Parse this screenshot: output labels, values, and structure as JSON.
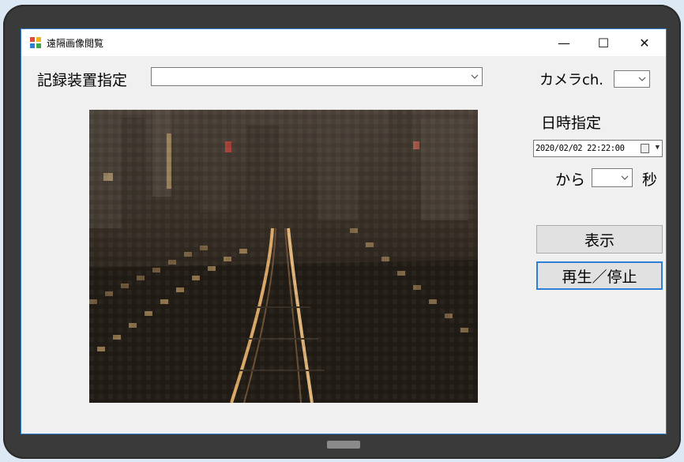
{
  "window": {
    "title": "遠隔画像閲覧",
    "minimize_glyph": "—",
    "maximize_glyph": "☐",
    "close_glyph": "✕"
  },
  "controls": {
    "device_label": "記録装置指定",
    "device_value": "",
    "camera_label": "カメラch.",
    "camera_value": "",
    "datetime_label": "日時指定",
    "datetime_value": "2020/02/02 22:22:00",
    "from_label": "から",
    "seconds_value": "",
    "seconds_unit": "秒",
    "show_button": "表示",
    "play_pause_button": "再生／停止"
  },
  "icons": {
    "app": "app-window-icon",
    "dropdown": "chevron-down-icon",
    "calendar": "calendar-icon"
  },
  "colors": {
    "accent": "#2f7fd6",
    "frame": "#3a3a3a",
    "window_bg": "#f0f0f0"
  }
}
